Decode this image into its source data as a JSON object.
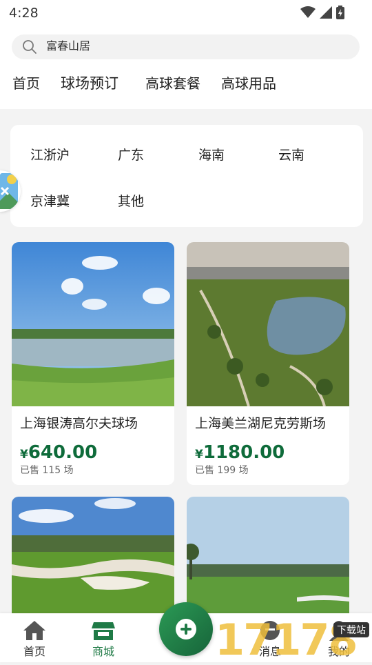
{
  "status_bar": {
    "time": "4:28"
  },
  "search": {
    "query": "富春山居"
  },
  "tabs": [
    {
      "label": "首页"
    },
    {
      "label": "球场预订"
    },
    {
      "label": "高球套餐"
    },
    {
      "label": "高球用品"
    }
  ],
  "regions": [
    {
      "label": "江浙沪"
    },
    {
      "label": "广东"
    },
    {
      "label": "海南"
    },
    {
      "label": "云南"
    },
    {
      "label": "京津冀"
    },
    {
      "label": "其他"
    }
  ],
  "products": [
    {
      "name": "上海银涛高尔夫球场",
      "currency": "¥",
      "price": "640.00",
      "sold": "已售 115 场"
    },
    {
      "name": "上海美兰湖尼克劳斯场",
      "currency": "¥",
      "price": "1180.00",
      "sold": "已售 199 场"
    },
    {
      "name": "",
      "currency": "",
      "price": "",
      "sold": ""
    },
    {
      "name": "",
      "currency": "",
      "price": "",
      "sold": ""
    }
  ],
  "bottom_nav": [
    {
      "label": "首页"
    },
    {
      "label": "商城"
    },
    {
      "label": "消息"
    },
    {
      "label": "我的"
    }
  ],
  "watermark": {
    "number": "17178",
    "tag": "下载站"
  },
  "colors": {
    "accent": "#1f7a46",
    "price": "#0e6b3a",
    "background": "#f3f3f3"
  }
}
